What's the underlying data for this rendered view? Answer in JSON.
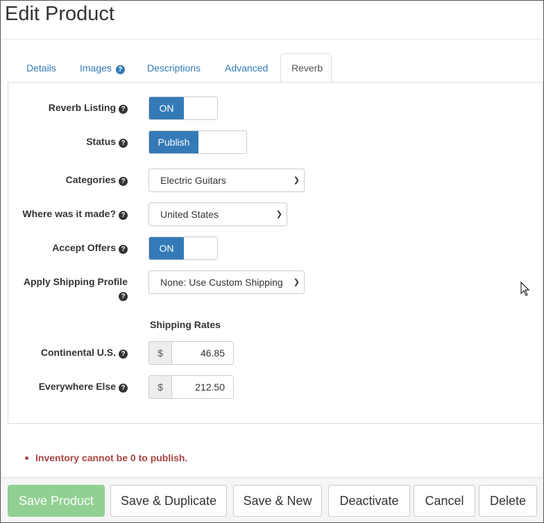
{
  "page": {
    "title": "Edit Product"
  },
  "tabs": [
    {
      "label": "Details"
    },
    {
      "label": "Images"
    },
    {
      "label": "Descriptions"
    },
    {
      "label": "Advanced"
    },
    {
      "label": "Reverb"
    }
  ],
  "form": {
    "reverb_listing": {
      "label": "Reverb Listing",
      "value": "ON"
    },
    "status": {
      "label": "Status",
      "value": "Publish"
    },
    "categories": {
      "label": "Categories",
      "value": "Electric Guitars"
    },
    "made_in": {
      "label": "Where was it made?",
      "value": "United States"
    },
    "accept_offers": {
      "label": "Accept Offers",
      "value": "ON"
    },
    "shipping_profile": {
      "label": "Apply Shipping Profile",
      "value": "None: Use Custom Shipping"
    },
    "shipping_rates_heading": "Shipping Rates",
    "continental_us": {
      "label": "Continental U.S.",
      "currency": "$",
      "value": "46.85"
    },
    "everywhere_else": {
      "label": "Everywhere Else",
      "currency": "$",
      "value": "212.50"
    }
  },
  "errors": [
    "Inventory cannot be 0 to publish."
  ],
  "footer": {
    "save_product": "Save Product",
    "save_duplicate": "Save & Duplicate",
    "save_new": "Save & New",
    "deactivate": "Deactivate",
    "cancel": "Cancel",
    "delete": "Delete"
  },
  "colors": {
    "primary": "#337ab7",
    "success_disabled": "#91d092",
    "error": "#a94442"
  }
}
